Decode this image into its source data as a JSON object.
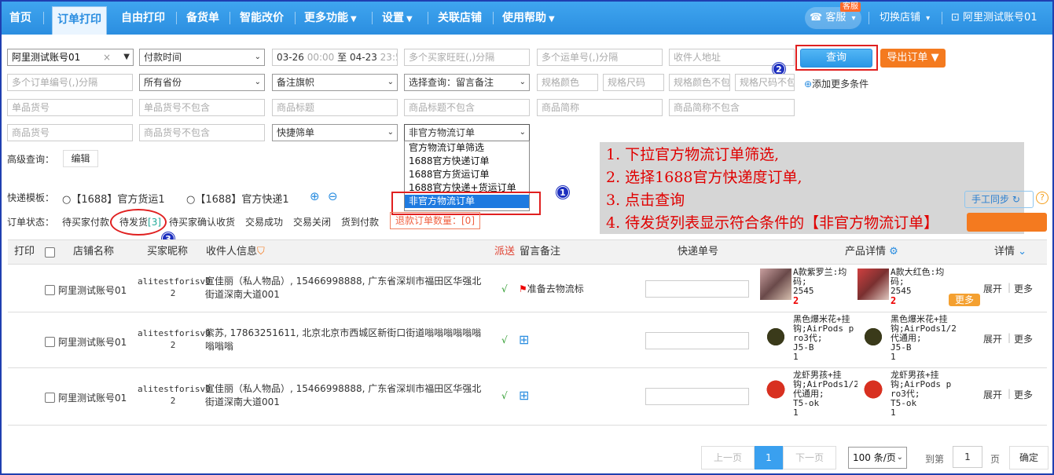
{
  "nav": {
    "items": [
      "首页",
      "订单打印",
      "自由打印",
      "备货单",
      "智能改价",
      "更多功能",
      "设置",
      "关联店铺",
      "使用帮助"
    ],
    "service": "客服",
    "service_badge": "客服",
    "switch_shop": "切换店铺",
    "account": "阿里测试账号01"
  },
  "filters": {
    "shop": "阿里测试账号01",
    "time_type": "付款时间",
    "date_from": "03-26",
    "date_from_time": "00:00",
    "date_to_label": "至",
    "date_to": "04-23",
    "date_to_time": "23:59",
    "buyers_ph": "多个买家旺旺(,)分隔",
    "waybills_ph": "多个运单号(,)分隔",
    "address_ph": "收件人地址",
    "query_button": "查询",
    "export_button": "导出订单",
    "orders_ph": "多个订单编号(,)分隔",
    "province": "所有省份",
    "remark_flag": "备注旗帜",
    "select_query": "选择查询：留言备注",
    "spec_color": "规格颜色",
    "spec_size": "规格尺码",
    "spec_color_not": "规格颜色不包含",
    "spec_size_not": "规格尺码不包含",
    "add_more": "添加更多条件",
    "sku_ph": "单品货号",
    "sku_not_ph": "单品货号不包含",
    "title_ph": "商品标题",
    "title_not_ph": "商品标题不包含",
    "short_ph": "商品简称",
    "short_not_ph": "商品简称不包含",
    "item_no_ph": "商品货号",
    "item_no_not_ph": "商品货号不包含",
    "quick_filter": "快捷筛单",
    "logistics_select": "非官方物流订单",
    "advanced_label": "高级查询：",
    "edit_button": "编辑"
  },
  "dropdown": {
    "options": [
      "官方物流订单筛选",
      "1688官方快递订单",
      "1688官方货运订单",
      "1688官方快递+货运订单",
      "非官方物流订单"
    ]
  },
  "annotation": {
    "lines": [
      "1. 下拉官方物流订单筛选,",
      "2. 选择1688官方快递度订单,",
      "3. 点击查询",
      "4. 待发货列表显示符合条件的【非官方物流订单】"
    ]
  },
  "markers": [
    "1",
    "2",
    "3"
  ],
  "templates": {
    "label": "快递模板：",
    "options": [
      "【1688】官方货运1",
      "【1688】官方快递1"
    ]
  },
  "status": {
    "label": "订单状态：",
    "tabs": [
      "待买家付款",
      "待发货",
      "待买家确认收货",
      "交易成功",
      "交易关闭",
      "货到付款"
    ],
    "pending_count": "[3]",
    "refund": "退款订单数量：[0]",
    "manual_sync": "手工同步"
  },
  "table": {
    "headers": [
      "打印",
      "店铺名称",
      "买家昵称",
      "收件人信息",
      "派送",
      "留言备注",
      "快递单号",
      "产品详情",
      "详情"
    ],
    "rows": [
      {
        "shop": "阿里测试账号01",
        "buyer_1": "alitestforisv0",
        "buyer_2": "2",
        "recipient": "宣佳丽（私人物品）, 15466998888, 广东省深圳市福田区华强北街道深南大道001",
        "remark": "准备去物流标",
        "p1": [
          "A款紫罗兰:均",
          "码;",
          "2545"
        ],
        "p1_qty": "2",
        "p2": [
          "A款大红色:均",
          "码;",
          "2545"
        ],
        "p2_qty": "2",
        "more_badge": "更多"
      },
      {
        "shop": "阿里测试账号01",
        "buyer_1": "alitestforisv0",
        "buyer_2": "2",
        "recipient": "紫苏, 17863251611, 北京北京市西城区新街口街道嗡嗡嗡嗡嗡嗡嗡嗡嗡",
        "p1": [
          "黑色爆米花+挂",
          "钩;AirPods p",
          "ro3代;",
          "J5-B",
          "1"
        ],
        "p2": [
          "黑色爆米花+挂",
          "钩;AirPods1/2",
          "代通用;",
          "J5-B",
          "1"
        ]
      },
      {
        "shop": "阿里测试账号01",
        "buyer_1": "alitestforisv0",
        "buyer_2": "2",
        "recipient": "宣佳丽（私人物品）, 15466998888, 广东省深圳市福田区华强北街道深南大道001",
        "p1": [
          "龙虾男孩+挂",
          "钩;AirPods1/2",
          "代通用;",
          "T5-ok",
          "1"
        ],
        "p2": [
          "龙虾男孩+挂",
          "钩;AirPods p",
          "ro3代;",
          "T5-ok",
          "1"
        ]
      }
    ],
    "expand": "展开",
    "more": "更多",
    "check": "√"
  },
  "pager": {
    "prev": "上一页",
    "current": "1",
    "next": "下一页",
    "size": "100 条/页",
    "goto": "到第",
    "page_input": "1",
    "page_unit": "页",
    "confirm": "确定"
  }
}
